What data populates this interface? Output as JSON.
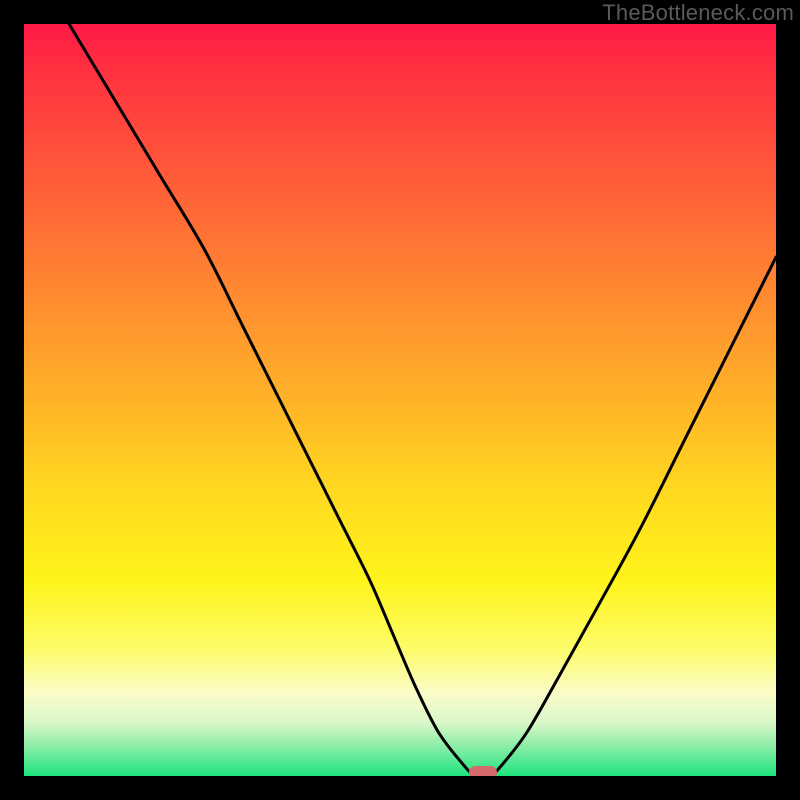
{
  "watermark": "TheBottleneck.com",
  "colors": {
    "frame": "#000000",
    "curve": "#000000",
    "marker": "#d46a6a"
  },
  "chart_data": {
    "type": "line",
    "title": "",
    "xlabel": "",
    "ylabel": "",
    "xlim": [
      0,
      100
    ],
    "ylim": [
      0,
      100
    ],
    "grid": false,
    "curve": {
      "note": "y = bottleneck percentage (0 at optimal point, 100 at top). x = relative component balance.",
      "points": [
        {
          "x": 6,
          "y": 100
        },
        {
          "x": 12,
          "y": 90
        },
        {
          "x": 18,
          "y": 80
        },
        {
          "x": 24,
          "y": 70
        },
        {
          "x": 29,
          "y": 60
        },
        {
          "x": 34,
          "y": 50
        },
        {
          "x": 38,
          "y": 42
        },
        {
          "x": 42,
          "y": 34
        },
        {
          "x": 46,
          "y": 26
        },
        {
          "x": 49,
          "y": 19
        },
        {
          "x": 52,
          "y": 12
        },
        {
          "x": 55,
          "y": 6
        },
        {
          "x": 58,
          "y": 2
        },
        {
          "x": 60,
          "y": 0
        },
        {
          "x": 62,
          "y": 0
        },
        {
          "x": 64,
          "y": 2
        },
        {
          "x": 67,
          "y": 6
        },
        {
          "x": 71,
          "y": 13
        },
        {
          "x": 76,
          "y": 22
        },
        {
          "x": 82,
          "y": 33
        },
        {
          "x": 88,
          "y": 45
        },
        {
          "x": 94,
          "y": 57
        },
        {
          "x": 100,
          "y": 69
        }
      ]
    },
    "marker": {
      "x": 61,
      "y": 0
    },
    "gradient_stops": [
      {
        "pos": 0.0,
        "color": "#ff1a47"
      },
      {
        "pos": 0.2,
        "color": "#ff5a3a"
      },
      {
        "pos": 0.5,
        "color": "#ffb328"
      },
      {
        "pos": 0.74,
        "color": "#fff41a"
      },
      {
        "pos": 0.89,
        "color": "#fbfcc8"
      },
      {
        "pos": 1.0,
        "color": "#1fe37e"
      }
    ]
  }
}
